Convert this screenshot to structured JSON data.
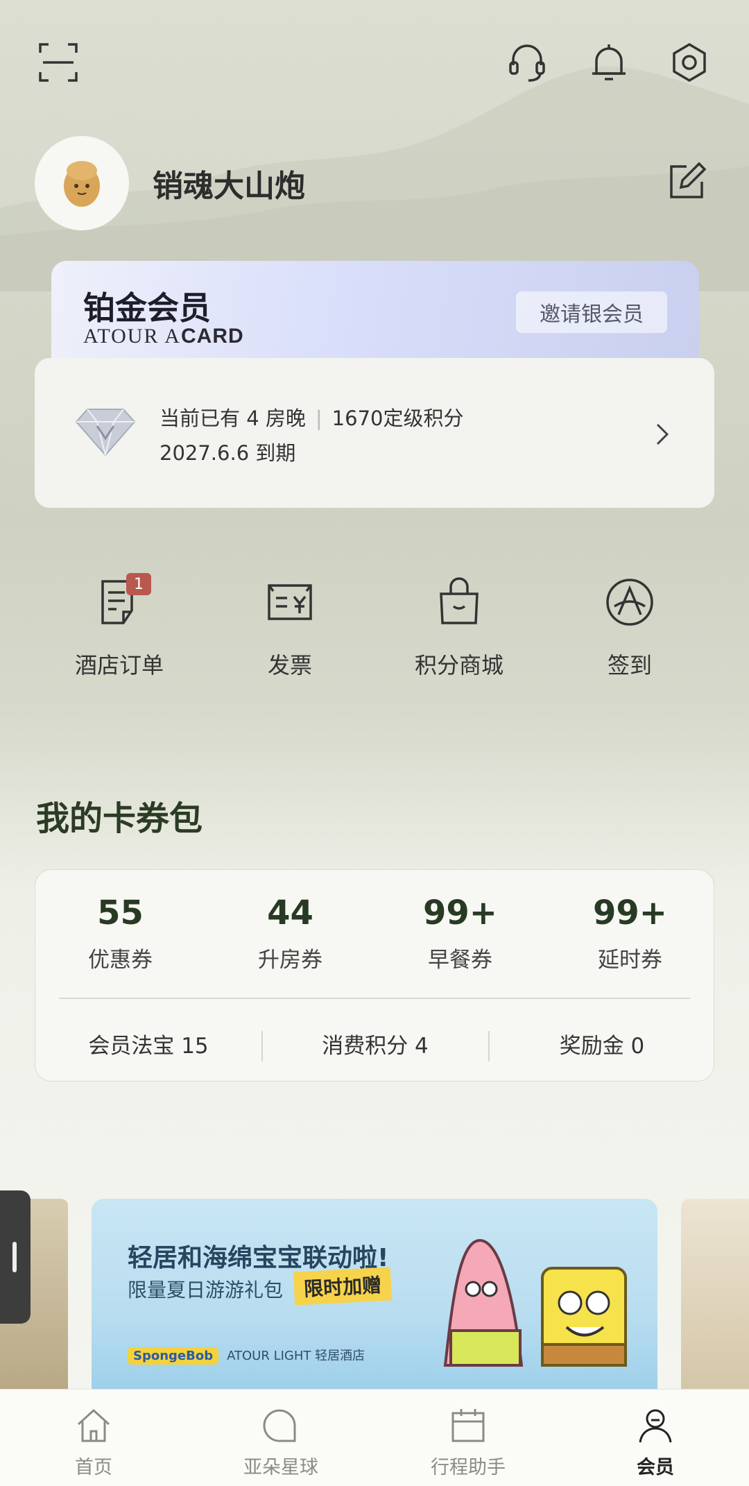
{
  "header": {
    "icons": [
      "scan-icon",
      "customer-service-icon",
      "bell-icon",
      "settings-icon"
    ]
  },
  "profile": {
    "username": "销魂大山炮"
  },
  "membership": {
    "level": "铂金会员",
    "brand_light": "ATOUR A",
    "brand_bold": "CARD",
    "invite_label": "邀请银会员",
    "nights_text": "当前已有 4 房晚",
    "points_text": "1670定级积分",
    "expiry_text": "2027.6.6 到期"
  },
  "quick_actions": [
    {
      "label": "酒店订单",
      "icon": "order-icon",
      "badge": "1"
    },
    {
      "label": "发票",
      "icon": "invoice-icon"
    },
    {
      "label": "积分商城",
      "icon": "shopping-bag-icon"
    },
    {
      "label": "签到",
      "icon": "checkin-icon"
    }
  ],
  "wallet": {
    "title": "我的卡券包",
    "coupons": [
      {
        "count": "55",
        "label": "优惠券"
      },
      {
        "count": "44",
        "label": "升房券"
      },
      {
        "count": "99+",
        "label": "早餐券"
      },
      {
        "count": "99+",
        "label": "延时券"
      }
    ],
    "bottom": [
      {
        "text": "会员法宝  15"
      },
      {
        "text": "消费积分  4"
      },
      {
        "text": "奖励金  0"
      }
    ]
  },
  "banner": {
    "title": "轻居和海绵宝宝联动啦!",
    "subtitle": "限量夏日游游礼包",
    "tag": "限时加赠",
    "logo_left": "SpongeBob",
    "logo_right": "ATOUR LIGHT 轻居酒店"
  },
  "tabbar": [
    {
      "label": "首页",
      "icon": "home-icon"
    },
    {
      "label": "亚朵星球",
      "icon": "planet-icon"
    },
    {
      "label": "行程助手",
      "icon": "calendar-icon"
    },
    {
      "label": "会员",
      "icon": "member-icon",
      "active": true
    }
  ],
  "colors": {
    "accent_green": "#283a23",
    "badge_red": "#b8584f",
    "card_purple": "#d9defa"
  }
}
